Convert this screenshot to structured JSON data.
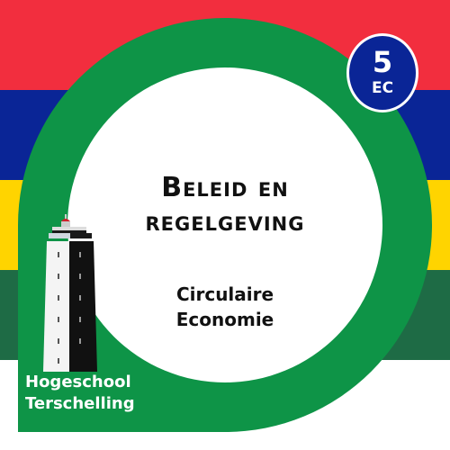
{
  "colors": {
    "red": "#F22E3E",
    "blue": "#0A2596",
    "yellow": "#FFD400",
    "dark_green": "#1E6B45",
    "ring_green": "#0E9447",
    "badge_blue": "#0A2596",
    "white": "#FFFFFF"
  },
  "course": {
    "title_line1": "Beleid en",
    "title_line2": "regelgeving",
    "subtitle_line1": "Circulaire",
    "subtitle_line2": "Economie"
  },
  "credits": {
    "value": "5",
    "unit": "EC"
  },
  "organization": {
    "line1": "Hogeschool",
    "line2": "Terschelling",
    "logo_icon": "lighthouse-icon"
  }
}
